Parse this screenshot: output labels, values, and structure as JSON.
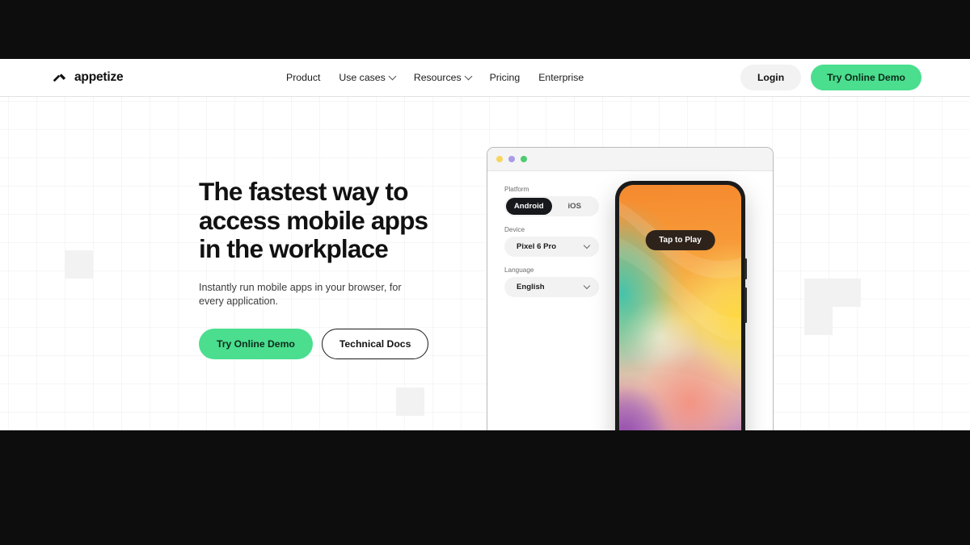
{
  "brand": {
    "name": "appetize",
    "logo_icon": "appetize-logo-icon"
  },
  "nav": {
    "items": [
      {
        "label": "Product",
        "has_chevron": false
      },
      {
        "label": "Use cases",
        "has_chevron": true
      },
      {
        "label": "Resources",
        "has_chevron": true
      },
      {
        "label": "Pricing",
        "has_chevron": false
      },
      {
        "label": "Enterprise",
        "has_chevron": false
      }
    ]
  },
  "header_actions": {
    "login_label": "Login",
    "demo_label": "Try Online Demo"
  },
  "hero": {
    "title_part1": "The ",
    "title_highlight": "fastest",
    "title_part2": " way to",
    "title_line2": "access mobile apps",
    "title_line3": "in the workplace",
    "subtitle": "Instantly run mobile apps in your browser, for every application.",
    "primary_cta": "Try Online Demo",
    "secondary_cta": "Technical Docs"
  },
  "demo_panel": {
    "window_dots": [
      "yellow",
      "purple",
      "green"
    ],
    "controls": {
      "platform": {
        "label": "Platform",
        "options": [
          "Android",
          "iOS"
        ],
        "selected": "Android"
      },
      "device": {
        "label": "Device",
        "value": "Pixel 6 Pro"
      },
      "language": {
        "label": "Language",
        "value": "English"
      }
    },
    "phone": {
      "tap_label": "Tap to Play"
    }
  },
  "colors": {
    "accent_green": "#4ade8e",
    "highlight_purple": "#c9c2f0",
    "dark": "#0d0d0d",
    "dot_yellow": "#f7d65e",
    "dot_purple": "#a99ce8",
    "dot_green": "#4ecb74"
  }
}
